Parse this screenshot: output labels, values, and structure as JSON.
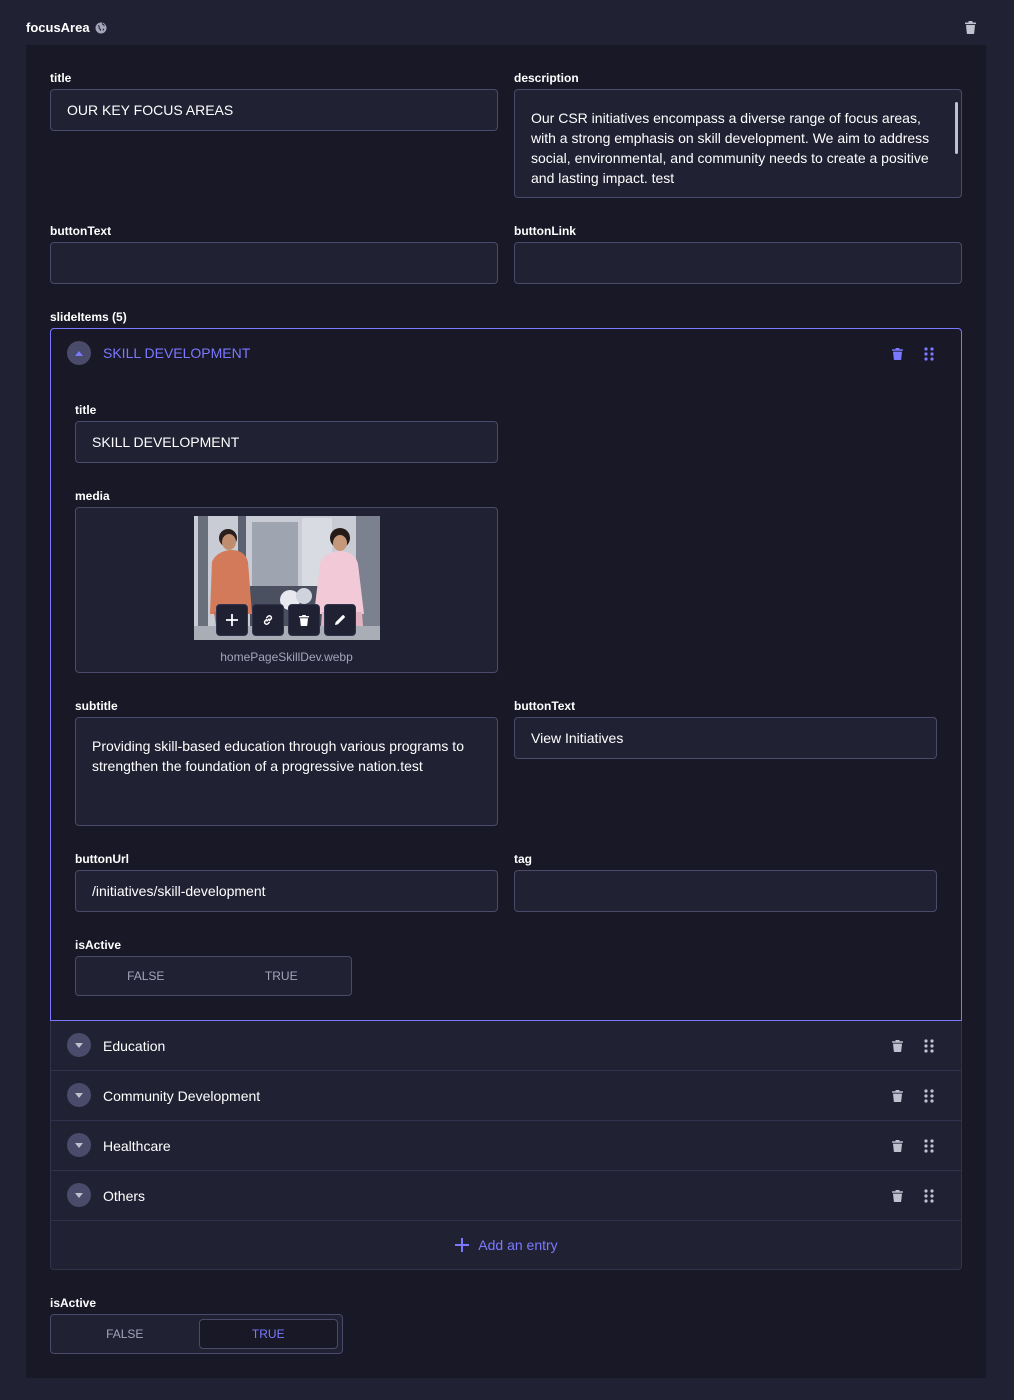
{
  "header": {
    "title": "focusArea",
    "globe_icon": "globe-icon",
    "delete_icon": "trash-icon"
  },
  "fields": {
    "title": {
      "label": "title",
      "value": "OUR KEY FOCUS AREAS"
    },
    "description": {
      "label": "description",
      "value": "Our CSR initiatives encompass a diverse range of focus areas, with a strong emphasis on skill development. We aim to address social, environmental, and community needs to create a positive and lasting impact. test"
    },
    "buttonText": {
      "label": "buttonText",
      "value": ""
    },
    "buttonLink": {
      "label": "buttonLink",
      "value": ""
    }
  },
  "slideItems": {
    "label": "slideItems (5)",
    "expanded": {
      "header_title": "SKILL DEVELOPMENT",
      "title": {
        "label": "title",
        "value": "SKILL DEVELOPMENT"
      },
      "media": {
        "label": "media",
        "filename": "homePageSkillDev.webp",
        "actions": [
          "add-icon",
          "link-icon",
          "trash-icon",
          "pencil-icon"
        ]
      },
      "subtitle": {
        "label": "subtitle",
        "value": "Providing skill-based education through various programs to strengthen the foundation of a progressive nation.test"
      },
      "buttonText": {
        "label": "buttonText",
        "value": "View Initiatives"
      },
      "buttonUrl": {
        "label": "buttonUrl",
        "value": "/initiatives/skill-development"
      },
      "tag": {
        "label": "tag",
        "value": ""
      },
      "isActive": {
        "label": "isActive",
        "false_label": "FALSE",
        "true_label": "TRUE",
        "selected": "none"
      }
    },
    "collapsed": [
      {
        "title": "Education"
      },
      {
        "title": "Community Development"
      },
      {
        "title": "Healthcare"
      },
      {
        "title": "Others"
      }
    ],
    "add_entry_label": "Add an entry"
  },
  "isActive": {
    "label": "isActive",
    "false_label": "FALSE",
    "true_label": "TRUE",
    "selected": "TRUE"
  },
  "colors": {
    "accent": "#7b79ff",
    "background": "#181826",
    "surface": "#212134",
    "border": "#4a4a6a"
  }
}
